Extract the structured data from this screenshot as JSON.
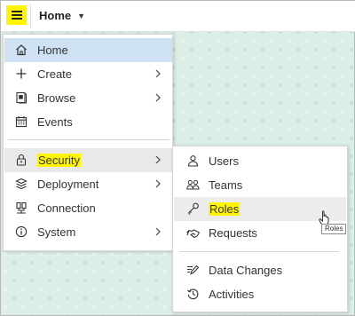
{
  "header": {
    "menu_icon": "hamburger-icon",
    "breadcrumb_label": "Home",
    "breadcrumb_icon": "caret-down-icon"
  },
  "main_menu": {
    "items": [
      {
        "label": "Home",
        "icon": "home-icon",
        "state": "active"
      },
      {
        "label": "Create",
        "icon": "plus-icon",
        "has_submenu": true
      },
      {
        "label": "Browse",
        "icon": "browse-icon",
        "has_submenu": true
      },
      {
        "label": "Events",
        "icon": "calendar-icon"
      },
      {
        "label": "Security",
        "icon": "lock-icon",
        "has_submenu": true,
        "state": "hover",
        "highlighted": true
      },
      {
        "label": "Deployment",
        "icon": "deployment-icon",
        "has_submenu": true
      },
      {
        "label": "Connection",
        "icon": "connection-icon"
      },
      {
        "label": "System",
        "icon": "info-icon",
        "has_submenu": true
      }
    ]
  },
  "security_submenu": {
    "items": [
      {
        "label": "Users",
        "icon": "user-icon"
      },
      {
        "label": "Teams",
        "icon": "teams-icon"
      },
      {
        "label": "Roles",
        "icon": "key-icon",
        "state": "hover",
        "highlighted": true
      },
      {
        "label": "Requests",
        "icon": "handshake-icon"
      },
      {
        "label": "Data Changes",
        "icon": "edit-icon"
      },
      {
        "label": "Activities",
        "icon": "history-icon"
      }
    ]
  },
  "tooltip": {
    "text": "Roles"
  },
  "colors": {
    "highlight": "#fff500",
    "active_item": "#cfe2f3",
    "hover_item": "#e9e9e9",
    "background": "#dcefe6"
  }
}
